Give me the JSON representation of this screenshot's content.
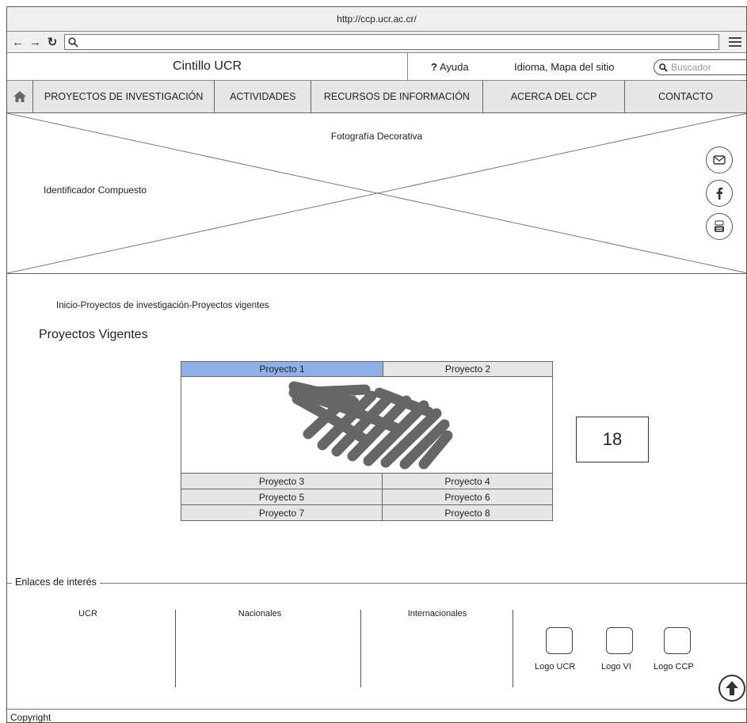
{
  "browser": {
    "url": "http://ccp.ucr.ac.cr/"
  },
  "header": {
    "cintillo": "Cintillo UCR",
    "help_mark": "?",
    "help": "Ayuda",
    "idioma": "Idioma, Mapa del sitio",
    "search_placeholder": "Buscador"
  },
  "nav": {
    "items": [
      "PROYECTOS DE INVESTIGACIÓN",
      "ACTIVIDADES",
      "RECURSOS DE INFORMACIÓN",
      "ACERCA DEL CCP",
      "CONTACTO"
    ]
  },
  "hero": {
    "caption": "Fotografía Decorativa",
    "identifier": "Identificador Compuesto"
  },
  "breadcrumb": "Inicio-Proyectos de investigación-Proyectos vigentes",
  "page_title": "Proyectos Vigentes",
  "tabs": [
    "Proyecto 1",
    "Proyecto 2"
  ],
  "projects": [
    [
      "Proyecto 3",
      "Proyecto 4"
    ],
    [
      "Proyecto 5",
      "Proyecto 6"
    ],
    [
      "Proyecto 7",
      "Proyecto 8"
    ]
  ],
  "badge": "18",
  "footer": {
    "links_label": "Enlaces de interés",
    "columns": [
      "UCR",
      "Nacionales",
      "Internacionales"
    ],
    "logos": [
      "Logo UCR",
      "Logo VI",
      "Logo CCP"
    ],
    "copyright": "Copyright"
  },
  "colors": {
    "active_tab": "#8fb0e6",
    "nav_bg": "#e6e6e6",
    "scribble": "#666666"
  }
}
